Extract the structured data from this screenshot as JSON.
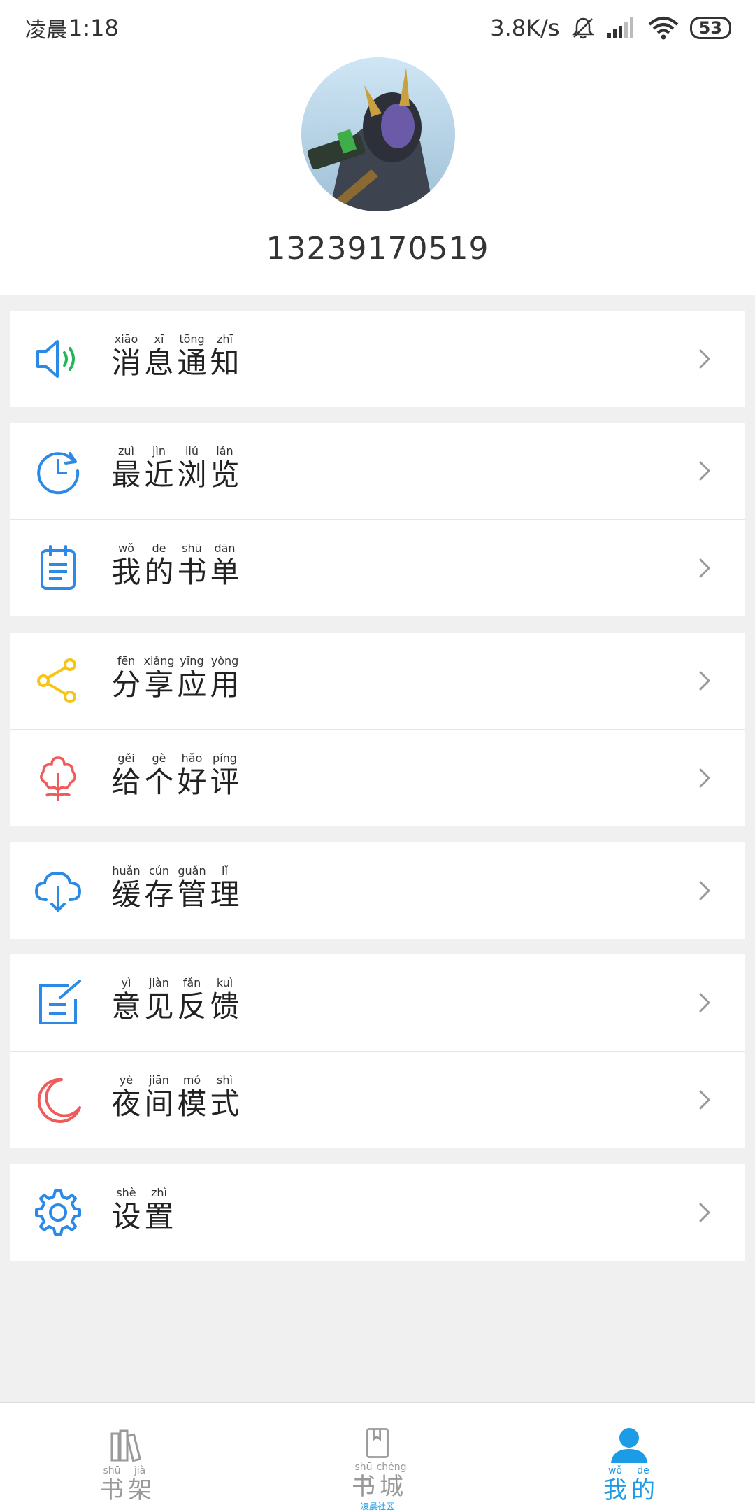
{
  "status_bar": {
    "time_prefix": "凌晨",
    "time": "1:18",
    "network_speed": "3.8K/s",
    "battery": "53",
    "icons": [
      "mute-icon",
      "signal-icon",
      "wifi-icon",
      "battery-icon"
    ]
  },
  "profile": {
    "phone": "13239170519"
  },
  "menu": [
    {
      "id": "notifications",
      "icon": "speaker-icon",
      "color": "#2b8ae6",
      "chars": [
        "消",
        "息",
        "通",
        "知"
      ],
      "pinyin": [
        "xiāo",
        "xī",
        "tōng",
        "zhī"
      ]
    },
    {
      "id": "recent",
      "icon": "clock-icon",
      "color": "#2b8ae6",
      "chars": [
        "最",
        "近",
        "浏",
        "览"
      ],
      "pinyin": [
        "zuì",
        "jìn",
        "liú",
        "lǎn"
      ]
    },
    {
      "id": "booklist",
      "icon": "clipboard-icon",
      "color": "#2b8ae6",
      "chars": [
        "我",
        "的",
        "书",
        "单"
      ],
      "pinyin": [
        "wǒ",
        "de",
        "shū",
        "dān"
      ]
    },
    {
      "id": "share",
      "icon": "share-icon",
      "color": "#f5c518",
      "chars": [
        "分",
        "享",
        "应",
        "用"
      ],
      "pinyin": [
        "fēn",
        "xiǎng",
        "yīng",
        "yòng"
      ]
    },
    {
      "id": "rate",
      "icon": "flower-icon",
      "color": "#ef5b5b",
      "chars": [
        "给",
        "个",
        "好",
        "评"
      ],
      "pinyin": [
        "gěi",
        "gè",
        "hǎo",
        "píng"
      ]
    },
    {
      "id": "cache",
      "icon": "cloud-download-icon",
      "color": "#2b8ae6",
      "chars": [
        "缓",
        "存",
        "管",
        "理"
      ],
      "pinyin": [
        "huǎn",
        "cún",
        "guǎn",
        "lǐ"
      ]
    },
    {
      "id": "feedback",
      "icon": "edit-icon",
      "color": "#2b8ae6",
      "chars": [
        "意",
        "见",
        "反",
        "馈"
      ],
      "pinyin": [
        "yì",
        "jiàn",
        "fǎn",
        "kuì"
      ]
    },
    {
      "id": "night",
      "icon": "moon-icon",
      "color": "#ef5b5b",
      "chars": [
        "夜",
        "间",
        "模",
        "式"
      ],
      "pinyin": [
        "yè",
        "jiān",
        "mó",
        "shì"
      ]
    },
    {
      "id": "settings",
      "icon": "gear-icon",
      "color": "#2b8ae6",
      "chars": [
        "设",
        "置"
      ],
      "pinyin": [
        "shè",
        "zhì"
      ]
    }
  ],
  "tabbar": [
    {
      "id": "bookshelf",
      "icon": "books-icon",
      "chars": [
        "书",
        "架"
      ],
      "pinyin": [
        "shū",
        "jià"
      ],
      "active": false,
      "sub": ""
    },
    {
      "id": "bookstore",
      "icon": "book-icon",
      "chars": [
        "书",
        "城"
      ],
      "pinyin": [
        "shū",
        "chéng"
      ],
      "active": false,
      "sub": "凌晨社区"
    },
    {
      "id": "mine",
      "icon": "user-icon",
      "chars": [
        "我",
        "的"
      ],
      "pinyin": [
        "wǒ",
        "de"
      ],
      "active": true,
      "sub": ""
    }
  ]
}
